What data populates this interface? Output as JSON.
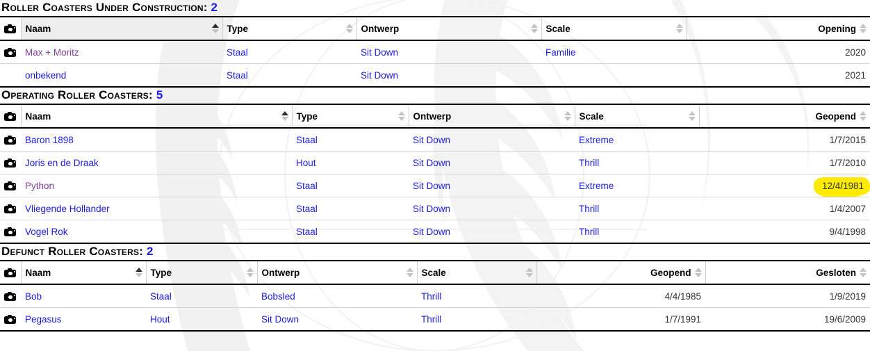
{
  "colors": {
    "link": "#1a1ae6",
    "visited_link": "#7d3f98",
    "heading_count": "#1a1ae6",
    "highlight": "#ffeb00",
    "sorted_header_bg": "#eeeeee"
  },
  "sections": [
    {
      "id": "under-construction",
      "title": "Roller Coasters Under Construction:",
      "count": "2",
      "columns": [
        {
          "key": "cam",
          "label": "",
          "align": "left",
          "sort": "none",
          "sorted_bg": false
        },
        {
          "key": "naam",
          "label": "Naam",
          "align": "left",
          "sort": "asc",
          "sorted_bg": true
        },
        {
          "key": "type",
          "label": "Type",
          "align": "left",
          "sort": "none",
          "sorted_bg": false
        },
        {
          "key": "ontwerp",
          "label": "Ontwerp",
          "align": "left",
          "sort": "none",
          "sorted_bg": false
        },
        {
          "key": "scale",
          "label": "Scale",
          "align": "left",
          "sort": "none",
          "sorted_bg": false
        },
        {
          "key": "datum",
          "label": "Opening",
          "align": "right",
          "sort": "none",
          "sorted_bg": false
        }
      ],
      "rows": [
        {
          "camera": true,
          "naam": "Max + Moritz",
          "naam_visited": true,
          "naam_link": true,
          "type": "Staal",
          "type_link": true,
          "ontwerp": "Sit Down",
          "ontwerp_link": true,
          "scale": "Familie",
          "scale_link": true,
          "datum": "2020",
          "datum_highlight": false
        },
        {
          "camera": false,
          "naam": "onbekend",
          "naam_visited": false,
          "naam_link": true,
          "type": "Staal",
          "type_link": true,
          "ontwerp": "Sit Down",
          "ontwerp_link": true,
          "scale": "",
          "scale_link": false,
          "datum": "2021",
          "datum_highlight": false
        }
      ]
    },
    {
      "id": "operating",
      "title": "Operating Roller Coasters:",
      "count": "5",
      "columns": [
        {
          "key": "cam",
          "label": "",
          "align": "left",
          "sort": "none",
          "sorted_bg": false
        },
        {
          "key": "naam",
          "label": "Naam",
          "align": "left",
          "sort": "asc",
          "sorted_bg": false
        },
        {
          "key": "type",
          "label": "Type",
          "align": "left",
          "sort": "none",
          "sorted_bg": false
        },
        {
          "key": "ontwerp",
          "label": "Ontwerp",
          "align": "left",
          "sort": "none",
          "sorted_bg": false
        },
        {
          "key": "scale",
          "label": "Scale",
          "align": "left",
          "sort": "none",
          "sorted_bg": false
        },
        {
          "key": "datum",
          "label": "Geopend",
          "align": "right",
          "sort": "none",
          "sorted_bg": false
        }
      ],
      "rows": [
        {
          "camera": true,
          "naam": "Baron 1898",
          "naam_visited": false,
          "naam_link": true,
          "type": "Staal",
          "type_link": true,
          "ontwerp": "Sit Down",
          "ontwerp_link": true,
          "scale": "Extreme",
          "scale_link": true,
          "datum": "1/7/2015",
          "datum_highlight": false
        },
        {
          "camera": true,
          "naam": "Joris en de Draak",
          "naam_visited": false,
          "naam_link": true,
          "type": "Hout",
          "type_link": true,
          "ontwerp": "Sit Down",
          "ontwerp_link": true,
          "scale": "Thrill",
          "scale_link": true,
          "datum": "1/7/2010",
          "datum_highlight": false
        },
        {
          "camera": true,
          "naam": "Python",
          "naam_visited": true,
          "naam_link": true,
          "type": "Staal",
          "type_link": true,
          "ontwerp": "Sit Down",
          "ontwerp_link": true,
          "scale": "Extreme",
          "scale_link": true,
          "datum": "12/4/1981",
          "datum_highlight": true
        },
        {
          "camera": true,
          "naam": "Vliegende Hollander",
          "naam_visited": false,
          "naam_link": true,
          "type": "Staal",
          "type_link": true,
          "ontwerp": "Sit Down",
          "ontwerp_link": true,
          "scale": "Thrill",
          "scale_link": true,
          "datum": "1/4/2007",
          "datum_highlight": false
        },
        {
          "camera": true,
          "naam": "Vogel Rok",
          "naam_visited": false,
          "naam_link": true,
          "type": "Staal",
          "type_link": true,
          "ontwerp": "Sit Down",
          "ontwerp_link": true,
          "scale": "Thrill",
          "scale_link": true,
          "datum": "9/4/1998",
          "datum_highlight": false
        }
      ]
    },
    {
      "id": "defunct",
      "title": "Defunct Roller Coasters:",
      "count": "2",
      "columns": [
        {
          "key": "cam",
          "label": "",
          "align": "left",
          "sort": "none",
          "sorted_bg": false
        },
        {
          "key": "naam",
          "label": "Naam",
          "align": "left",
          "sort": "asc",
          "sorted_bg": false
        },
        {
          "key": "type",
          "label": "Type",
          "align": "left",
          "sort": "none",
          "sorted_bg": false
        },
        {
          "key": "ontwerp",
          "label": "Ontwerp",
          "align": "left",
          "sort": "none",
          "sorted_bg": false
        },
        {
          "key": "scale",
          "label": "Scale",
          "align": "left",
          "sort": "none",
          "sorted_bg": false
        },
        {
          "key": "geopend",
          "label": "Geopend",
          "align": "right",
          "sort": "none",
          "sorted_bg": false
        },
        {
          "key": "gesloten",
          "label": "Gesloten",
          "align": "right",
          "sort": "none",
          "sorted_bg": false
        }
      ],
      "rows": [
        {
          "camera": true,
          "naam": "Bob",
          "naam_visited": false,
          "naam_link": true,
          "type": "Staal",
          "type_link": true,
          "ontwerp": "Bobsled",
          "ontwerp_link": true,
          "scale": "Thrill",
          "scale_link": true,
          "geopend": "4/4/1985",
          "gesloten": "1/9/2019"
        },
        {
          "camera": true,
          "naam": "Pegasus",
          "naam_visited": false,
          "naam_link": true,
          "type": "Hout",
          "type_link": true,
          "ontwerp": "Sit Down",
          "ontwerp_link": true,
          "scale": "Thrill",
          "scale_link": true,
          "geopend": "1/7/1991",
          "gesloten": "19/6/2009"
        }
      ]
    }
  ]
}
